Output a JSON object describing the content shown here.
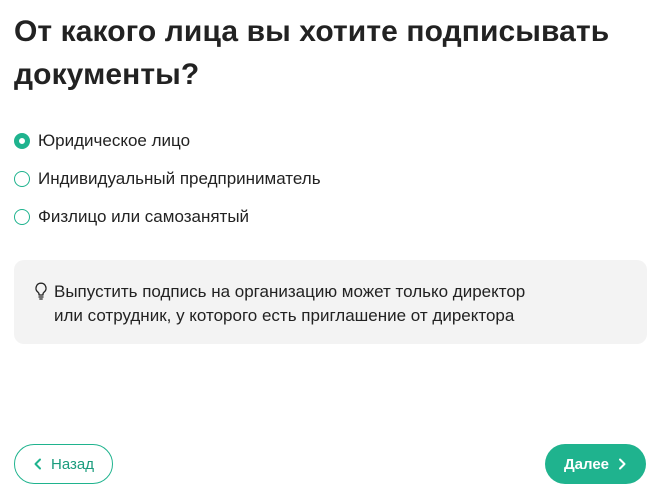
{
  "title": "От какого лица вы хотите подписывать документы?",
  "options": [
    {
      "label": "Юридическое лицо",
      "checked": true
    },
    {
      "label": "Индивидуальный предприниматель",
      "checked": false
    },
    {
      "label": "Физлицо или самозанятый",
      "checked": false
    }
  ],
  "info": {
    "icon": "lightbulb-icon",
    "line1": "Выпустить подпись на организацию может только директор",
    "line2": "или сотрудник, у которого есть приглашение от директора"
  },
  "buttons": {
    "back_label": "Назад",
    "next_label": "Далее"
  },
  "colors": {
    "accent": "#1fb38e",
    "text": "#222222",
    "info_bg": "#f3f3f3"
  }
}
